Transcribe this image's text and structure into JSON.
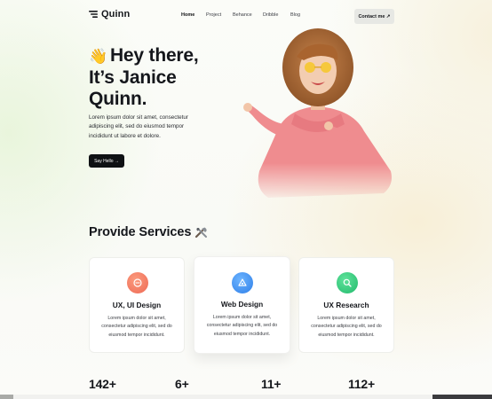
{
  "brand": {
    "name": "Quinn"
  },
  "nav": {
    "links": [
      "Home",
      "Project",
      "Behance",
      "Dribble",
      "Blog"
    ],
    "active": "Home",
    "contact_label": "Contact me ↗"
  },
  "hero": {
    "greeting_icon": "waving-hand-icon",
    "title_line1": "Hey there,",
    "title_line2": "It’s Janice",
    "title_line3": "Quinn.",
    "description": "Lorem ipsum dolor sit amet, consectetur adipiscing elit, sed do eiusmod tempor incididunt ut labore et dolore.",
    "cta_label": "Say Hello →"
  },
  "services": {
    "title": "Provide Services",
    "title_icon": "tools-icon",
    "cards": [
      {
        "title": "UX, UI Design",
        "icon": "design-icon",
        "color": "#f0735a",
        "description": "Lorem ipsum dolor sit amet, consectetur adipiscing elit, sed do eiusmod tempor incididunt."
      },
      {
        "title": "Web Design",
        "icon": "web-icon",
        "color": "#3d8ff2",
        "description": "Lorem ipsum dolor sit amet, consectetur adipiscing elit, sed do eiusmod tempor incididunt."
      },
      {
        "title": "UX Research",
        "icon": "research-icon",
        "color": "#2fc77a",
        "description": "Lorem ipsum dolor sit amet, consectetur adipiscing elit, sed do eiusmod tempor incididunt."
      }
    ]
  },
  "stats": [
    "142+",
    "6+",
    "11+",
    "112+"
  ]
}
